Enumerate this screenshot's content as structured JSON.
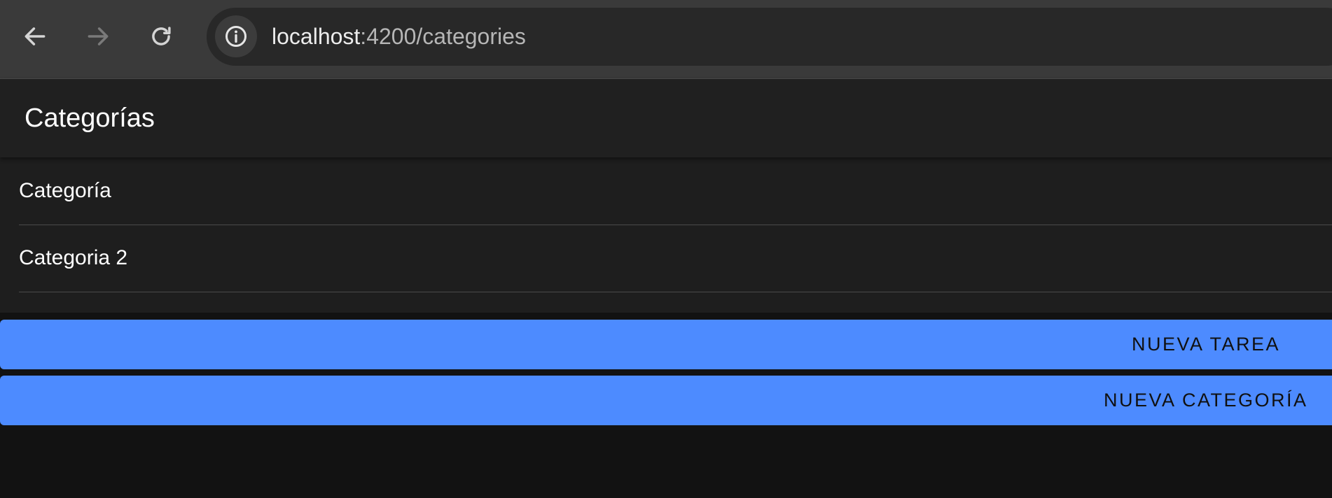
{
  "browser": {
    "back_icon": "back-arrow-icon",
    "forward_icon": "forward-arrow-icon",
    "reload_icon": "reload-icon",
    "site_info_icon": "info-icon",
    "url_host": "localhost",
    "url_rest": ":4200/categories"
  },
  "header": {
    "title": "Categorías"
  },
  "categories": [
    {
      "label": "Categoría"
    },
    {
      "label": "Categoria 2"
    }
  ],
  "actions": {
    "new_task_label": "NUEVA TAREA",
    "new_category_label": "NUEVA CATEGORÍA"
  },
  "colors": {
    "accent": "#4d8bff",
    "header_bg": "#202020",
    "page_bg": "#121212"
  }
}
